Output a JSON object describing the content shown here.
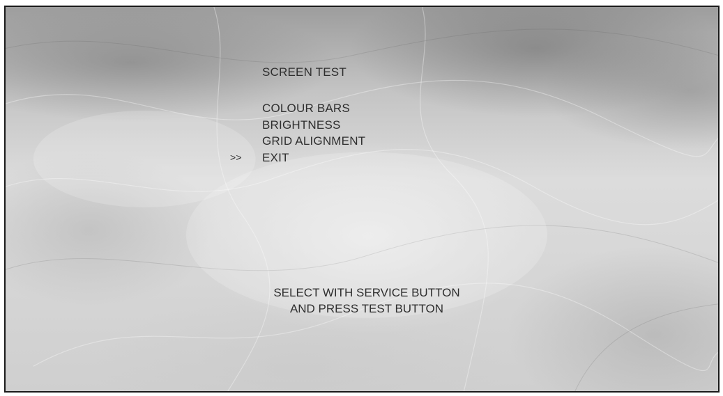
{
  "screen": {
    "title": "SCREEN TEST",
    "cursor": ">>",
    "menu_items": [
      {
        "label": "COLOUR BARS",
        "selected": false
      },
      {
        "label": "BRIGHTNESS",
        "selected": false
      },
      {
        "label": "GRID ALIGNMENT",
        "selected": false
      },
      {
        "label": "EXIT",
        "selected": true
      }
    ],
    "instructions": [
      "SELECT WITH SERVICE BUTTON",
      "AND PRESS TEST BUTTON"
    ]
  }
}
